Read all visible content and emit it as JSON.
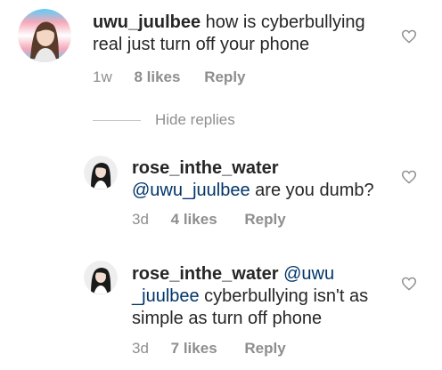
{
  "comments": [
    {
      "username": "uwu_juulbee",
      "text_line1": " how is cyberbullying",
      "text_line2": "real just turn off your phone",
      "time": "1w",
      "likes": "8 likes",
      "reply": "Reply"
    }
  ],
  "hide_replies": "Hide replies",
  "replies": [
    {
      "username": "rose_inthe_water",
      "mention": "@uwu_juulbee",
      "text_line2_rest": " are you dumb?",
      "time": "3d",
      "likes": "4 likes",
      "reply": "Reply"
    },
    {
      "username": "rose_inthe_water",
      "mention_part1": " @uwu",
      "mention_part2": "_juulbee",
      "text_line2_rest": " cyberbullying isn't as",
      "text_line3": "simple as turn off phone",
      "time": "3d",
      "likes": "7 likes",
      "reply": "Reply"
    }
  ]
}
